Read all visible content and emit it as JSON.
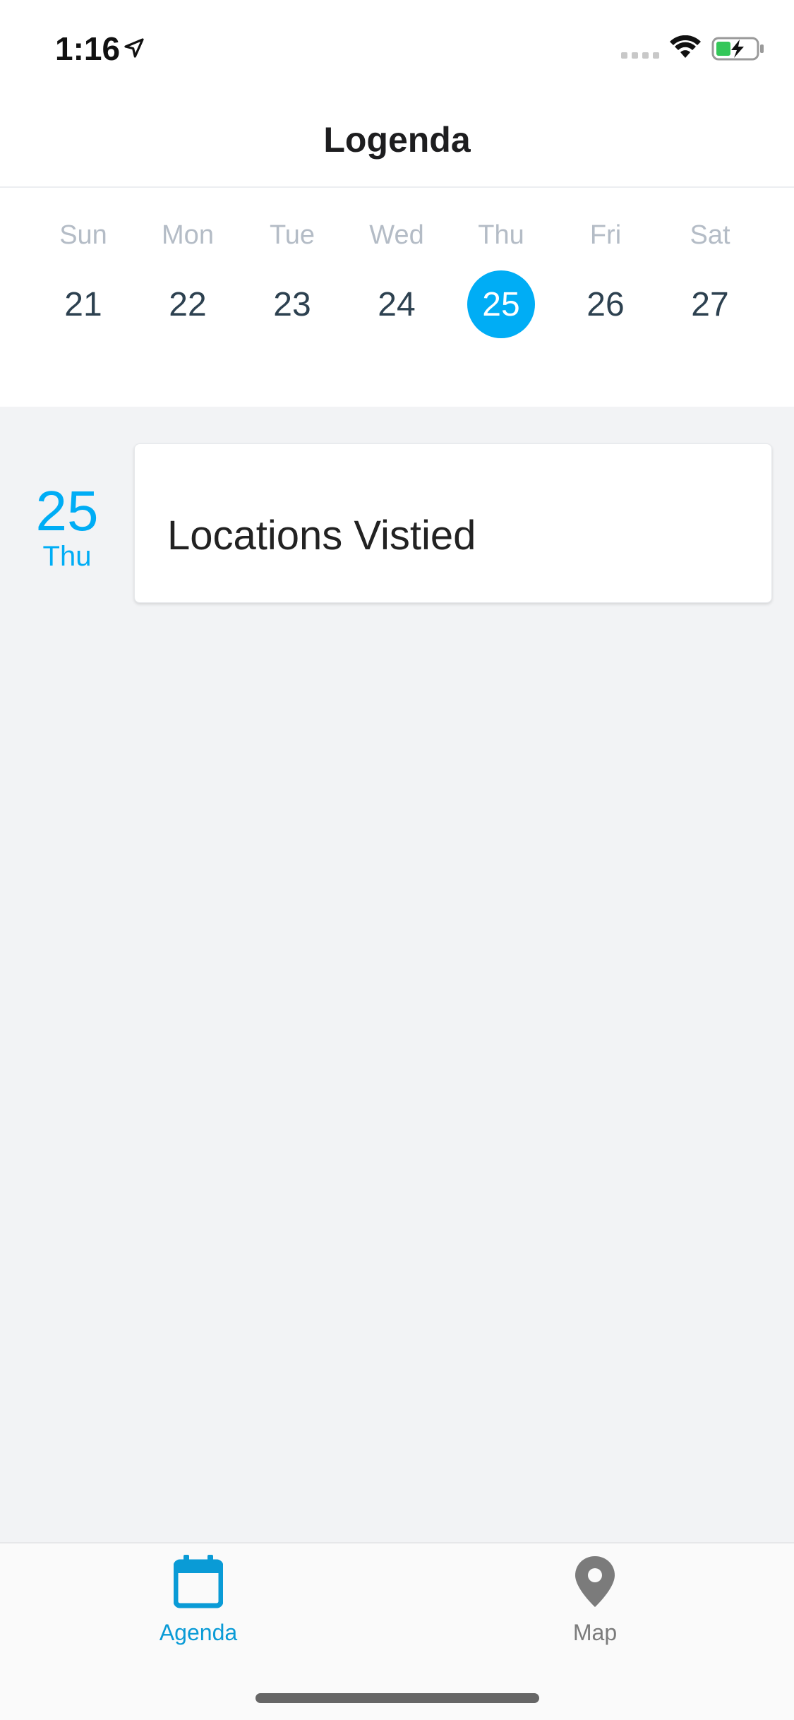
{
  "status_bar": {
    "time": "1:16"
  },
  "header": {
    "title": "Logenda"
  },
  "calendar": {
    "days": [
      {
        "name": "Sun",
        "num": "21",
        "selected": false
      },
      {
        "name": "Mon",
        "num": "22",
        "selected": false
      },
      {
        "name": "Tue",
        "num": "23",
        "selected": false
      },
      {
        "name": "Wed",
        "num": "24",
        "selected": false
      },
      {
        "name": "Thu",
        "num": "25",
        "selected": true
      },
      {
        "name": "Fri",
        "num": "26",
        "selected": false
      },
      {
        "name": "Sat",
        "num": "27",
        "selected": false
      }
    ],
    "selected_color": "#00adf5"
  },
  "agenda": {
    "date_num": "25",
    "date_day": "Thu",
    "item_title": "Locations Vistied"
  },
  "tabs": [
    {
      "label": "Agenda",
      "icon": "calendar-icon",
      "active": true
    },
    {
      "label": "Map",
      "icon": "map-pin-icon",
      "active": false
    }
  ],
  "colors": {
    "accent": "#00adf5",
    "tab_active": "#0a9bd6",
    "tab_inactive": "#7b7b7b",
    "agenda_bg": "#f2f3f5"
  }
}
